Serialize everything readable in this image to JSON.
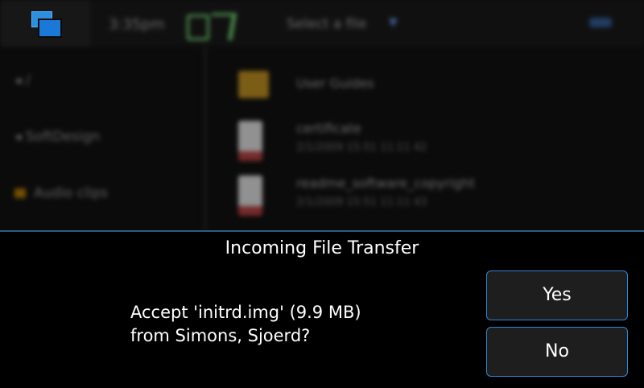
{
  "background_app": {
    "time": "3:35pm",
    "title": "Select a file",
    "left_items": [
      {
        "label": "/"
      },
      {
        "label": "SoftDesign"
      },
      {
        "label": "Audio clips"
      }
    ],
    "files": [
      {
        "name": "User Guides",
        "meta": ""
      },
      {
        "name": "certificate",
        "meta": "2/1/2009 15:51 11:11 42"
      },
      {
        "name": "readme_software_copyright",
        "meta": "2/1/2009 15:51 11:11 43"
      }
    ]
  },
  "dialog": {
    "title": "Incoming File Transfer",
    "message_line1": "Accept 'initrd.img' (9.9 MB)",
    "message_line2": "from Simons, Sjoerd?",
    "yes_label": "Yes",
    "no_label": "No"
  },
  "colors": {
    "accent": "#2e86d4",
    "switcher_icon": "#2d8fe0",
    "button_bg": "#1e1e1e",
    "dialog_bg": "#000000"
  },
  "icons": {
    "switcher": "task-switcher-icon",
    "folder": "folder-icon",
    "document": "document-icon",
    "dropdown": "chevron-down-icon"
  }
}
